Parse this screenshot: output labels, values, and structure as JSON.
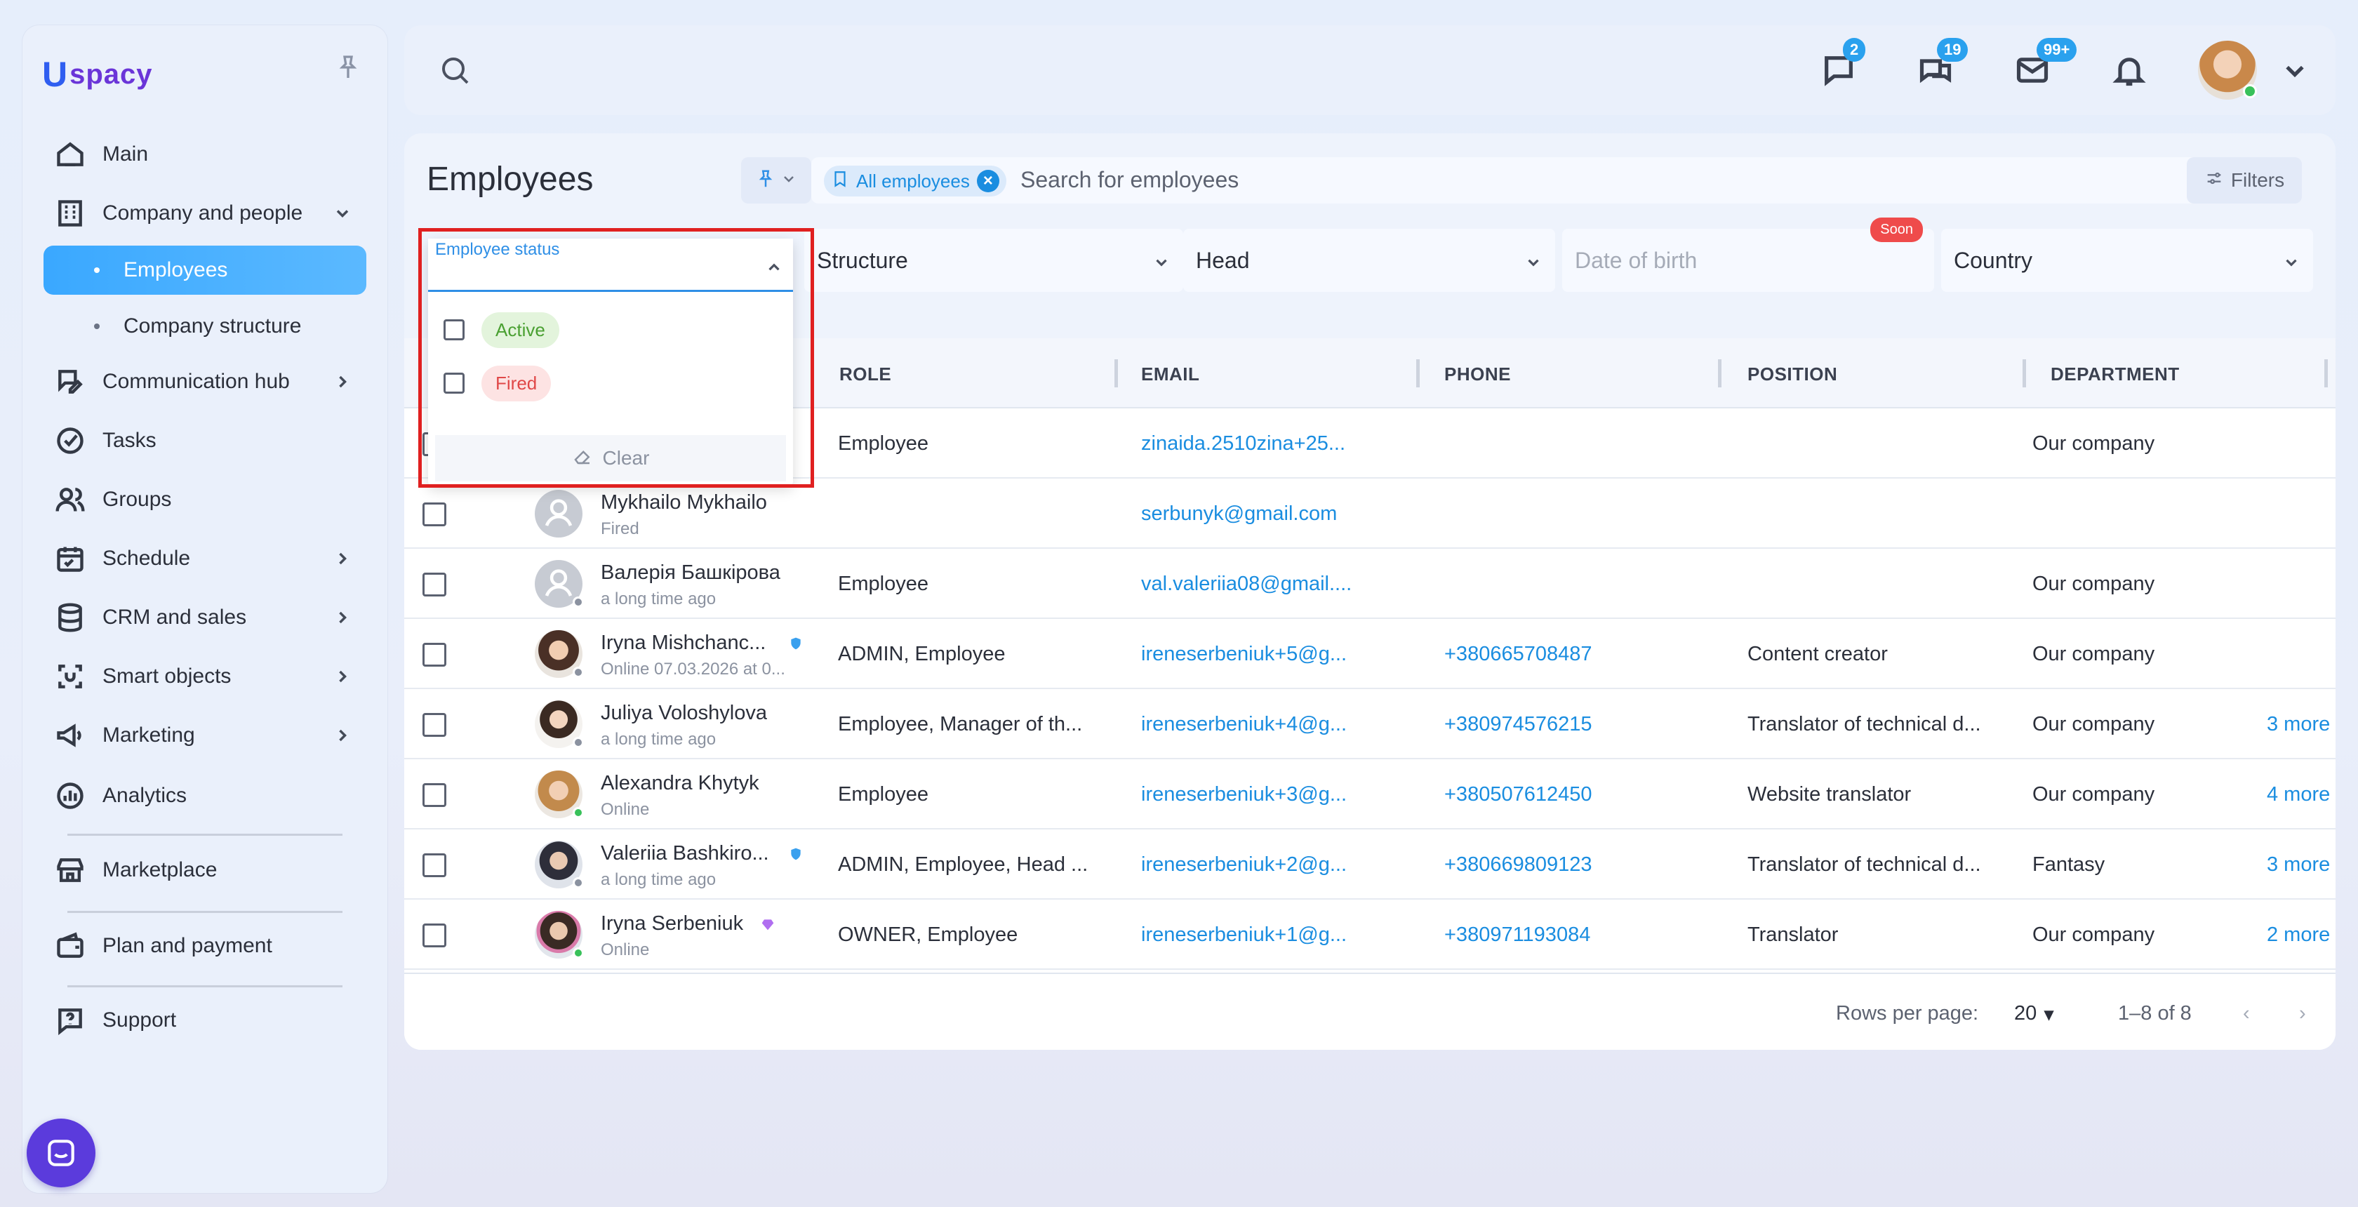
{
  "sidebar": {
    "logo": {
      "prefix": "U",
      "text": "spacy"
    },
    "items": [
      {
        "label": "Main",
        "icon": "home-icon"
      },
      {
        "label": "Company and people",
        "icon": "building-icon"
      },
      {
        "label": "Employees"
      },
      {
        "label": "Company structure"
      },
      {
        "label": "Communication hub",
        "icon": "chat-edit-icon"
      },
      {
        "label": "Tasks",
        "icon": "check-circle-icon"
      },
      {
        "label": "Groups",
        "icon": "users-icon"
      },
      {
        "label": "Schedule",
        "icon": "calendar-icon"
      },
      {
        "label": "CRM and sales",
        "icon": "database-icon"
      },
      {
        "label": "Smart objects",
        "icon": "scan-icon"
      },
      {
        "label": "Marketing",
        "icon": "megaphone-icon"
      },
      {
        "label": "Analytics",
        "icon": "chart-icon"
      },
      {
        "label": "Marketplace",
        "icon": "store-icon"
      },
      {
        "label": "Plan and payment",
        "icon": "wallet-icon"
      },
      {
        "label": "Support",
        "icon": "help-icon"
      }
    ]
  },
  "topbar": {
    "badges": {
      "messages": "2",
      "chats": "19",
      "mail": "99+"
    }
  },
  "page": {
    "title": "Employees",
    "chip_label": "All employees",
    "search_placeholder": "Search for employees",
    "count": "8",
    "filters_label": "Filters"
  },
  "filters": {
    "employee_status": "Employee status",
    "structure": "Structure",
    "head": "Head",
    "date_of_birth": "Date of birth",
    "soon": "Soon",
    "country": "Country"
  },
  "dropdown": {
    "options": [
      {
        "label": "Active",
        "bg": "#e3f4dc",
        "color": "#4aa032"
      },
      {
        "label": "Fired",
        "bg": "#fde3e3",
        "color": "#e04848"
      }
    ],
    "clear_label": "Clear"
  },
  "table": {
    "headers": [
      "ROLE",
      "EMAIL",
      "PHONE",
      "POSITION",
      "DEPARTMENT"
    ],
    "rows": [
      {
        "name": "",
        "status": "",
        "role": "Employee",
        "email": "zinaida.2510zina+25...",
        "phone": "",
        "position": "",
        "department": "Our company",
        "more": ""
      },
      {
        "name": "Mykhailo Mykhailo",
        "status": "Fired",
        "role": "",
        "email": "serbunyk@gmail.com",
        "phone": "",
        "position": "",
        "department": "",
        "more": ""
      },
      {
        "name": "Валерія Башкірова",
        "status": "a long time ago",
        "role": "Employee",
        "email": "val.valeriia08@gmail....",
        "phone": "",
        "position": "",
        "department": "Our company",
        "more": ""
      },
      {
        "name": "Iryna Mishchanc...",
        "status": "Online 07.03.2026 at 0...",
        "role": "ADMIN, Employee",
        "email": "ireneserbeniuk+5@g...",
        "phone": "+380665708487",
        "position": "Content creator",
        "department": "Our company",
        "more": ""
      },
      {
        "name": "Juliya Voloshylova",
        "status": "a long time ago",
        "role": "Employee, Manager of th...",
        "email": "ireneserbeniuk+4@g...",
        "phone": "+380974576215",
        "position": "Translator of technical d...",
        "department": "Our company",
        "more": "3 more"
      },
      {
        "name": "Alexandra Khytyk",
        "status": "Online",
        "role": "Employee",
        "email": "ireneserbeniuk+3@g...",
        "phone": "+380507612450",
        "position": "Website translator",
        "department": "Our company",
        "more": "4 more"
      },
      {
        "name": "Valeriia Bashkiro...",
        "status": "a long time ago",
        "role": "ADMIN, Employee, Head ...",
        "email": "ireneserbeniuk+2@g...",
        "phone": "+380669809123",
        "position": "Translator of technical d...",
        "department": "Fantasy",
        "more": "3 more"
      },
      {
        "name": "Iryna Serbeniuk",
        "status": "Online",
        "role": "OWNER, Employee",
        "email": "ireneserbeniuk+1@g...",
        "phone": "+380971193084",
        "position": "Translator",
        "department": "Our company",
        "more": "2 more"
      }
    ],
    "footer": {
      "rows_per_page_label": "Rows per page:",
      "rows_per_page": "20",
      "range": "1–8 of 8"
    }
  }
}
